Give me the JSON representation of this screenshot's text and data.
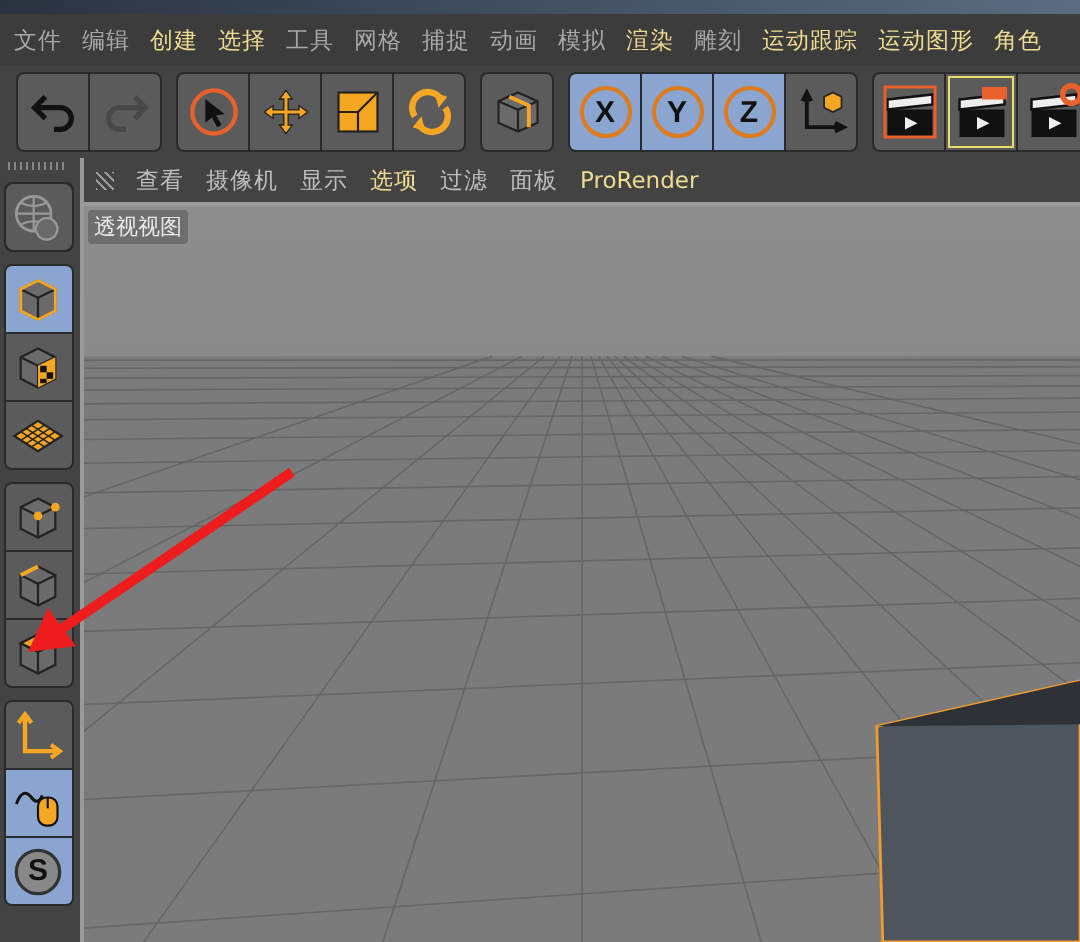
{
  "menu": [
    {
      "label": "文件",
      "highlighted": false
    },
    {
      "label": "编辑",
      "highlighted": false
    },
    {
      "label": "创建",
      "highlighted": true
    },
    {
      "label": "选择",
      "highlighted": true
    },
    {
      "label": "工具",
      "highlighted": false
    },
    {
      "label": "网格",
      "highlighted": false
    },
    {
      "label": "捕捉",
      "highlighted": false
    },
    {
      "label": "动画",
      "highlighted": false
    },
    {
      "label": "模拟",
      "highlighted": false
    },
    {
      "label": "渲染",
      "highlighted": true
    },
    {
      "label": "雕刻",
      "highlighted": false
    },
    {
      "label": "运动跟踪",
      "highlighted": true
    },
    {
      "label": "运动图形",
      "highlighted": true
    },
    {
      "label": "角色",
      "highlighted": true
    }
  ],
  "toolbar": [
    [
      {
        "kind": "undo",
        "selected": false,
        "disabled": false
      },
      {
        "kind": "redo",
        "selected": false,
        "disabled": true
      }
    ],
    [
      {
        "kind": "select",
        "selected": false,
        "disabled": false
      },
      {
        "kind": "move",
        "selected": false,
        "disabled": false
      },
      {
        "kind": "scale",
        "selected": false,
        "disabled": false
      },
      {
        "kind": "rotate",
        "selected": false,
        "disabled": false
      }
    ],
    [
      {
        "kind": "cube",
        "selected": false,
        "disabled": false
      }
    ],
    [
      {
        "kind": "axis-lock",
        "letter": "X",
        "selected": true,
        "disabled": false
      },
      {
        "kind": "axis-lock",
        "letter": "Y",
        "selected": true,
        "disabled": false
      },
      {
        "kind": "axis-lock",
        "letter": "Z",
        "selected": true,
        "disabled": false
      },
      {
        "kind": "coordinates",
        "selected": false,
        "disabled": false
      }
    ],
    [
      {
        "kind": "render-view",
        "selected": false,
        "disabled": false
      },
      {
        "kind": "render-picture",
        "selected": false,
        "disabled": false,
        "outlined": true
      },
      {
        "kind": "render-settings",
        "selected": false,
        "disabled": false
      }
    ]
  ],
  "palette": [
    [
      {
        "kind": "globe",
        "selected": false
      }
    ],
    [
      {
        "kind": "model",
        "selected": true
      },
      {
        "kind": "texture",
        "selected": false
      },
      {
        "kind": "workplane",
        "selected": false
      }
    ],
    [
      {
        "kind": "points",
        "selected": false
      },
      {
        "kind": "edges",
        "selected": false
      },
      {
        "kind": "polygons",
        "selected": false
      }
    ],
    [
      {
        "kind": "axis",
        "selected": false
      },
      {
        "kind": "tweak",
        "selected": true
      },
      {
        "kind": "snap",
        "letter": "S",
        "selected": true
      }
    ]
  ],
  "viewport_menu": [
    {
      "label": "查看",
      "highlighted": false
    },
    {
      "label": "摄像机",
      "highlighted": false
    },
    {
      "label": "显示",
      "highlighted": false
    },
    {
      "label": "选项",
      "highlighted": true
    },
    {
      "label": "过滤",
      "highlighted": false
    },
    {
      "label": "面板",
      "highlighted": false
    },
    {
      "label": "ProRender",
      "highlighted": true
    }
  ],
  "viewport": {
    "label": "透视视图"
  }
}
